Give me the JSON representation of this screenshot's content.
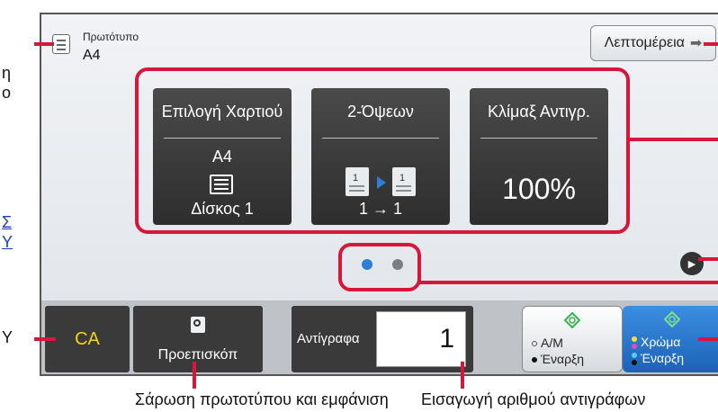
{
  "left_margin_fragments": [
    "η",
    "ο",
    "Σ",
    "Υ",
    "Y"
  ],
  "original": {
    "label": "Πρωτότυπο",
    "size": "A4"
  },
  "details_button": {
    "label": "Λεπτομέρεια"
  },
  "tiles": {
    "paper": {
      "title": "Επιλογή Χαρτιού",
      "value": "A4",
      "tray": "Δίσκος 1"
    },
    "duplex": {
      "title": "2-Όψεων",
      "page_left": "1",
      "page_right": "1",
      "value": "1 → 1"
    },
    "zoom": {
      "title": "Κλίμαξ Αντιγρ.",
      "value": "100%"
    }
  },
  "bottom": {
    "ca_label": "CA",
    "preview_label": "Προεπισκόπ",
    "copies_label": "Αντίγραφα",
    "copies_value": "1",
    "bw_line1": "A/M",
    "bw_line2": "Έναρξη",
    "color_line1": "Χρώμα",
    "color_line2": "Έναρξη"
  },
  "captions": {
    "left": "Σάρωση πρωτοτύπου και εμφάνιση",
    "right": "Εισαγωγή αριθμού αντιγράφων"
  },
  "colors": {
    "callout": "#d8163c",
    "accent_blue": "#2b7fd6",
    "ca_yellow": "#f5d21b",
    "start_green": "#2fb34a"
  }
}
